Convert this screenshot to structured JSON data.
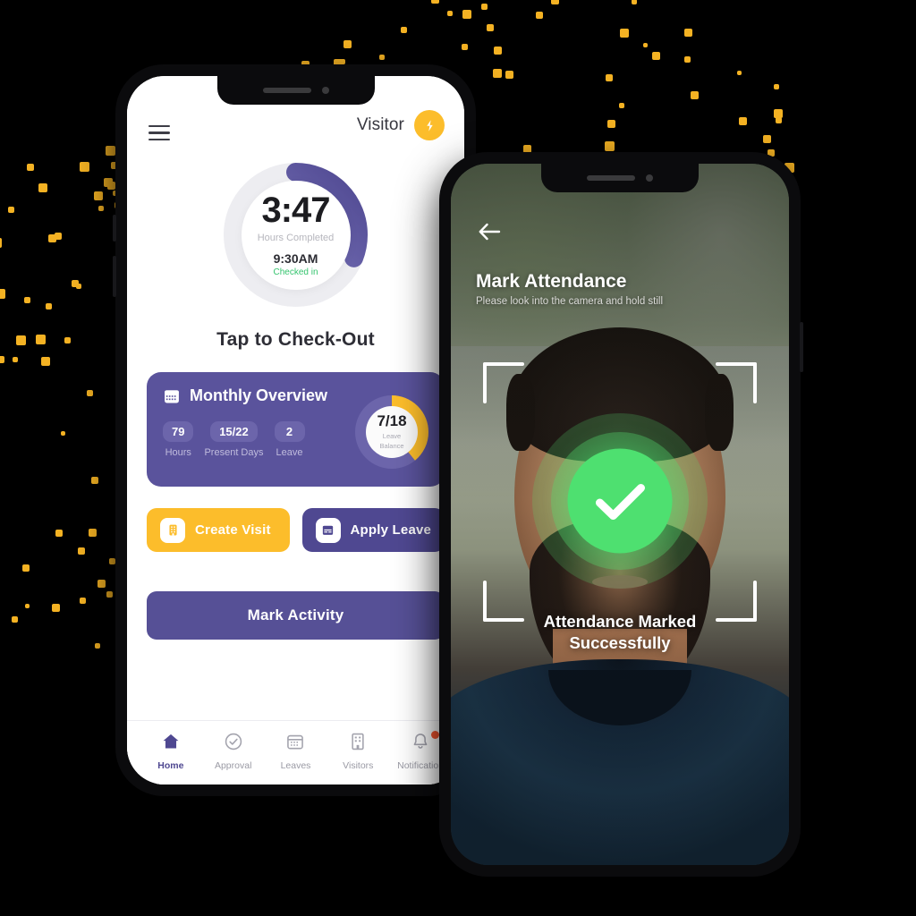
{
  "phone_home": {
    "header": {
      "menu_icon": "hamburger-menu-icon",
      "role_label": "Visitor",
      "swap_icon": "swap-profile-icon"
    },
    "timer": {
      "value": "3:47",
      "caption": "Hours Completed",
      "check_in_time": "9:30AM",
      "status": "Checked in",
      "progress_percent": 31,
      "ring_start_color": "#8a85c9",
      "ring_end_color": "#4f4891",
      "track_color": "#ededf1"
    },
    "check_action_label": "Tap to Check-Out",
    "monthly_overview": {
      "title": "Monthly Overview",
      "calendar_icon": "calendar-icon",
      "card_color": "#5a539c",
      "stats": [
        {
          "value": "79",
          "label": "Hours"
        },
        {
          "value": "15/22",
          "label": "Present Days"
        },
        {
          "value": "2",
          "label": "Leave"
        }
      ],
      "leave_donut": {
        "value": "7/18",
        "label_line1": "Leave",
        "label_line2": "Balance",
        "filled_percent": 39,
        "arc_color": "#fcbd2b",
        "track_color": "#6c65ab"
      }
    },
    "actions": [
      {
        "label": "Create Visit",
        "icon": "building-icon",
        "bg": "#fcbd2b"
      },
      {
        "label": "Apply Leave",
        "icon": "calendar-icon",
        "bg": "#4f4891"
      }
    ],
    "mark_activity_label": "Mark Activity",
    "tabs": [
      {
        "label": "Home",
        "icon": "home-icon",
        "active": true
      },
      {
        "label": "Approval",
        "icon": "check-circle-icon",
        "active": false
      },
      {
        "label": "Leaves",
        "icon": "calendar-icon",
        "active": false
      },
      {
        "label": "Visitors",
        "icon": "building-icon",
        "active": false
      },
      {
        "label": "Notification",
        "icon": "bell-icon",
        "active": false,
        "badge": true
      }
    ]
  },
  "phone_attendance": {
    "back_icon": "back-arrow-icon",
    "title": "Mark Attendance",
    "subtitle": "Please look into the camera and hold still",
    "scan_frame_icon": "face-scan-brackets-icon",
    "success_icon": "check-mark-icon",
    "success_color": "#4ee070",
    "success_message_line1": "Attendance Marked",
    "success_message_line2": "Successfully"
  },
  "background": {
    "color": "#000000",
    "dot_color": "#f4b223"
  }
}
